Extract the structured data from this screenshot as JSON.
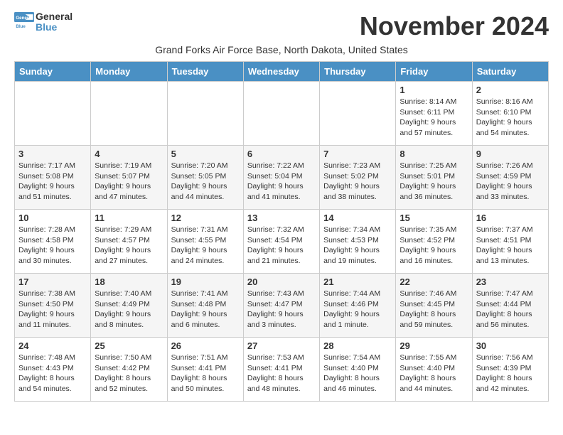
{
  "logo": {
    "general": "General",
    "blue": "Blue"
  },
  "title": "November 2024",
  "subtitle": "Grand Forks Air Force Base, North Dakota, United States",
  "days_of_week": [
    "Sunday",
    "Monday",
    "Tuesday",
    "Wednesday",
    "Thursday",
    "Friday",
    "Saturday"
  ],
  "weeks": [
    [
      {
        "day": "",
        "info": ""
      },
      {
        "day": "",
        "info": ""
      },
      {
        "day": "",
        "info": ""
      },
      {
        "day": "",
        "info": ""
      },
      {
        "day": "",
        "info": ""
      },
      {
        "day": "1",
        "info": "Sunrise: 8:14 AM\nSunset: 6:11 PM\nDaylight: 9 hours and 57 minutes."
      },
      {
        "day": "2",
        "info": "Sunrise: 8:16 AM\nSunset: 6:10 PM\nDaylight: 9 hours and 54 minutes."
      }
    ],
    [
      {
        "day": "3",
        "info": "Sunrise: 7:17 AM\nSunset: 5:08 PM\nDaylight: 9 hours and 51 minutes."
      },
      {
        "day": "4",
        "info": "Sunrise: 7:19 AM\nSunset: 5:07 PM\nDaylight: 9 hours and 47 minutes."
      },
      {
        "day": "5",
        "info": "Sunrise: 7:20 AM\nSunset: 5:05 PM\nDaylight: 9 hours and 44 minutes."
      },
      {
        "day": "6",
        "info": "Sunrise: 7:22 AM\nSunset: 5:04 PM\nDaylight: 9 hours and 41 minutes."
      },
      {
        "day": "7",
        "info": "Sunrise: 7:23 AM\nSunset: 5:02 PM\nDaylight: 9 hours and 38 minutes."
      },
      {
        "day": "8",
        "info": "Sunrise: 7:25 AM\nSunset: 5:01 PM\nDaylight: 9 hours and 36 minutes."
      },
      {
        "day": "9",
        "info": "Sunrise: 7:26 AM\nSunset: 4:59 PM\nDaylight: 9 hours and 33 minutes."
      }
    ],
    [
      {
        "day": "10",
        "info": "Sunrise: 7:28 AM\nSunset: 4:58 PM\nDaylight: 9 hours and 30 minutes."
      },
      {
        "day": "11",
        "info": "Sunrise: 7:29 AM\nSunset: 4:57 PM\nDaylight: 9 hours and 27 minutes."
      },
      {
        "day": "12",
        "info": "Sunrise: 7:31 AM\nSunset: 4:55 PM\nDaylight: 9 hours and 24 minutes."
      },
      {
        "day": "13",
        "info": "Sunrise: 7:32 AM\nSunset: 4:54 PM\nDaylight: 9 hours and 21 minutes."
      },
      {
        "day": "14",
        "info": "Sunrise: 7:34 AM\nSunset: 4:53 PM\nDaylight: 9 hours and 19 minutes."
      },
      {
        "day": "15",
        "info": "Sunrise: 7:35 AM\nSunset: 4:52 PM\nDaylight: 9 hours and 16 minutes."
      },
      {
        "day": "16",
        "info": "Sunrise: 7:37 AM\nSunset: 4:51 PM\nDaylight: 9 hours and 13 minutes."
      }
    ],
    [
      {
        "day": "17",
        "info": "Sunrise: 7:38 AM\nSunset: 4:50 PM\nDaylight: 9 hours and 11 minutes."
      },
      {
        "day": "18",
        "info": "Sunrise: 7:40 AM\nSunset: 4:49 PM\nDaylight: 9 hours and 8 minutes."
      },
      {
        "day": "19",
        "info": "Sunrise: 7:41 AM\nSunset: 4:48 PM\nDaylight: 9 hours and 6 minutes."
      },
      {
        "day": "20",
        "info": "Sunrise: 7:43 AM\nSunset: 4:47 PM\nDaylight: 9 hours and 3 minutes."
      },
      {
        "day": "21",
        "info": "Sunrise: 7:44 AM\nSunset: 4:46 PM\nDaylight: 9 hours and 1 minute."
      },
      {
        "day": "22",
        "info": "Sunrise: 7:46 AM\nSunset: 4:45 PM\nDaylight: 8 hours and 59 minutes."
      },
      {
        "day": "23",
        "info": "Sunrise: 7:47 AM\nSunset: 4:44 PM\nDaylight: 8 hours and 56 minutes."
      }
    ],
    [
      {
        "day": "24",
        "info": "Sunrise: 7:48 AM\nSunset: 4:43 PM\nDaylight: 8 hours and 54 minutes."
      },
      {
        "day": "25",
        "info": "Sunrise: 7:50 AM\nSunset: 4:42 PM\nDaylight: 8 hours and 52 minutes."
      },
      {
        "day": "26",
        "info": "Sunrise: 7:51 AM\nSunset: 4:41 PM\nDaylight: 8 hours and 50 minutes."
      },
      {
        "day": "27",
        "info": "Sunrise: 7:53 AM\nSunset: 4:41 PM\nDaylight: 8 hours and 48 minutes."
      },
      {
        "day": "28",
        "info": "Sunrise: 7:54 AM\nSunset: 4:40 PM\nDaylight: 8 hours and 46 minutes."
      },
      {
        "day": "29",
        "info": "Sunrise: 7:55 AM\nSunset: 4:40 PM\nDaylight: 8 hours and 44 minutes."
      },
      {
        "day": "30",
        "info": "Sunrise: 7:56 AM\nSunset: 4:39 PM\nDaylight: 8 hours and 42 minutes."
      }
    ]
  ]
}
